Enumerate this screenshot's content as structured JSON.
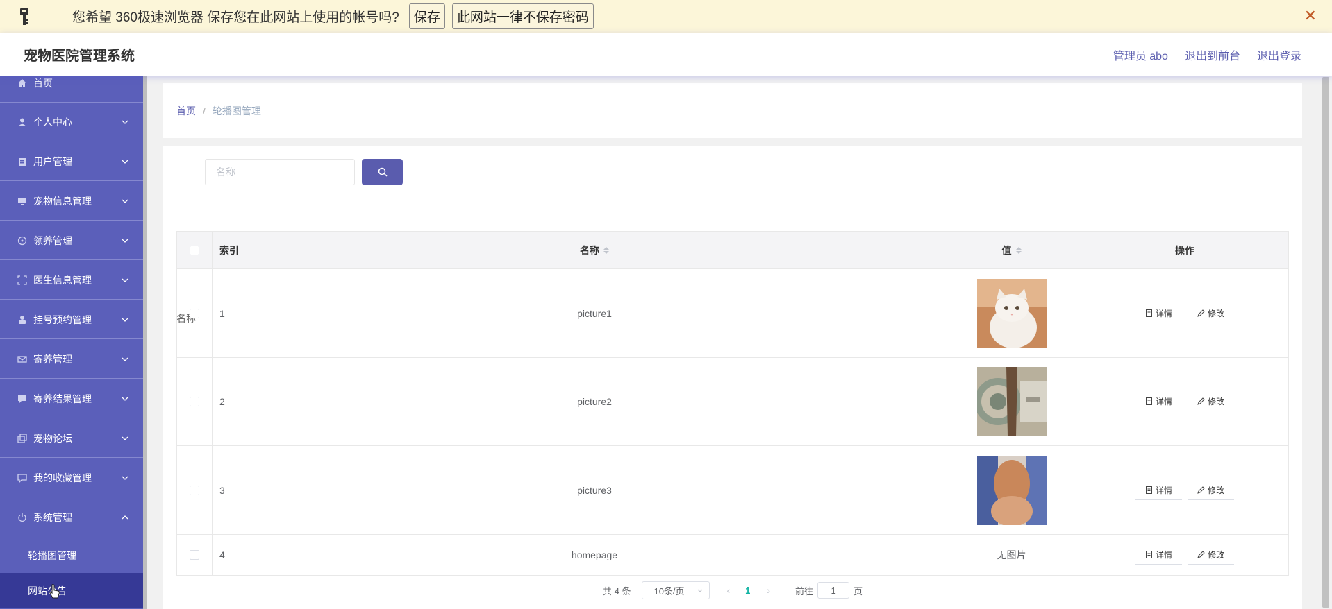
{
  "browser_bar": {
    "message": "您希望 360极速浏览器 保存您在此网站上使用的帐号吗?",
    "save_label": "保存",
    "never_label": "此网站一律不保存密码",
    "close_icon": "close-icon"
  },
  "header": {
    "title": "宠物医院管理系统",
    "admin": "管理员 abo",
    "to_front": "退出到前台",
    "logout": "退出登录"
  },
  "sidebar": {
    "items": [
      {
        "label": "首页",
        "icon": "home-icon"
      },
      {
        "label": "个人中心",
        "icon": "user-icon"
      },
      {
        "label": "用户管理",
        "icon": "clipboard-icon"
      },
      {
        "label": "宠物信息管理",
        "icon": "monitor-icon"
      },
      {
        "label": "领养管理",
        "icon": "target-icon"
      },
      {
        "label": "医生信息管理",
        "icon": "frame-icon"
      },
      {
        "label": "挂号预约管理",
        "icon": "person-icon"
      },
      {
        "label": "寄养管理",
        "icon": "mail-icon"
      },
      {
        "label": "寄养结果管理",
        "icon": "chat-icon"
      },
      {
        "label": "宠物论坛",
        "icon": "copy-icon"
      },
      {
        "label": "我的收藏管理",
        "icon": "message-icon"
      },
      {
        "label": "系统管理",
        "icon": "power-icon"
      }
    ],
    "sub_items": [
      {
        "label": "轮播图管理"
      },
      {
        "label": "网站公告"
      }
    ]
  },
  "breadcrumb": {
    "home": "首页",
    "separator": "/",
    "current": "轮播图管理"
  },
  "search": {
    "label": "名称",
    "placeholder": "名称",
    "value": ""
  },
  "table": {
    "headers": {
      "index": "索引",
      "name": "名称",
      "value": "值",
      "ops": "操作"
    },
    "rows": [
      {
        "index": "1",
        "name": "picture1",
        "value": "",
        "image": "white-kitten"
      },
      {
        "index": "2",
        "name": "picture2",
        "value": "",
        "image": "pet-photo"
      },
      {
        "index": "3",
        "name": "picture3",
        "value": "",
        "image": "pet-paw"
      },
      {
        "index": "4",
        "name": "homepage",
        "value": "无图片",
        "image": ""
      }
    ],
    "detail_label": "详情",
    "edit_label": "修改"
  },
  "pagination": {
    "total": "共 4 条",
    "page_size": "10条/页",
    "current_page": "1",
    "goto_label": "前往",
    "goto_value": "1",
    "page_unit": "页"
  },
  "colors": {
    "sidebar": "#5b5fba",
    "sidebar_active": "#363996",
    "primary": "#5a5cae",
    "current_page": "#12b4a3"
  }
}
